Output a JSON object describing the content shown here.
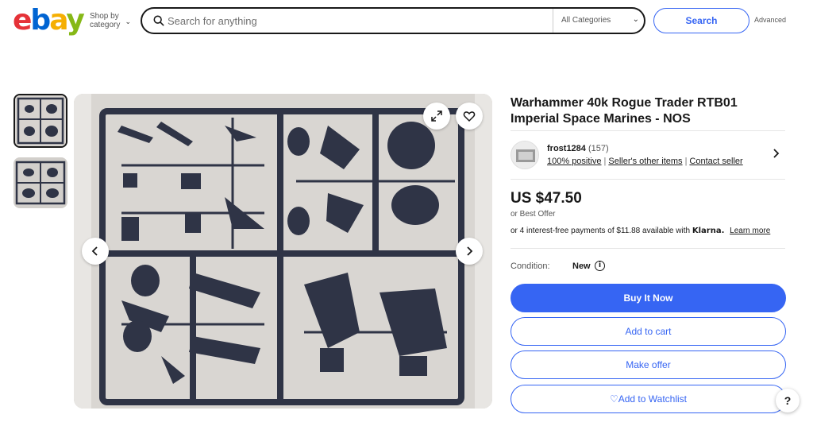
{
  "header": {
    "logo_letters": [
      "e",
      "b",
      "a",
      "y"
    ],
    "shop_by_label": "Shop by category",
    "search_placeholder": "Search for anything",
    "category_selected": "All Categories",
    "search_button": "Search",
    "advanced_link": "Advanced"
  },
  "gallery": {
    "thumbnail_count": 2,
    "active_index": 0
  },
  "listing": {
    "title": "Warhammer 40k Rogue Trader RTB01 Imperial Space Marines - NOS",
    "seller": {
      "name": "frost1284",
      "feedback_count": "(157)",
      "positive": "100% positive",
      "other_items": "Seller's other items",
      "contact": "Contact seller"
    },
    "price": "US $47.50",
    "best_offer": "or Best Offer",
    "installments": "or 4 interest-free payments of $11.88 available with",
    "klarna_brand": "Klarna.",
    "learn_more": "Learn more",
    "condition_label": "Condition:",
    "condition_value": "New"
  },
  "actions": {
    "buy_now": "Buy It Now",
    "add_to_cart": "Add to cart",
    "make_offer": "Make offer",
    "watchlist": "Add to Watchlist",
    "help": "?"
  },
  "colors": {
    "accent": "#3665f3",
    "ebay_red": "#e53238",
    "ebay_blue": "#0064d2",
    "ebay_yellow": "#f5af02",
    "ebay_green": "#86b817",
    "sprue": "#2f3446"
  },
  "icons": [
    "search-icon",
    "chevron-down-icon",
    "expand-icon",
    "heart-icon",
    "chevron-left-icon",
    "chevron-right-icon",
    "info-icon",
    "help-icon"
  ]
}
